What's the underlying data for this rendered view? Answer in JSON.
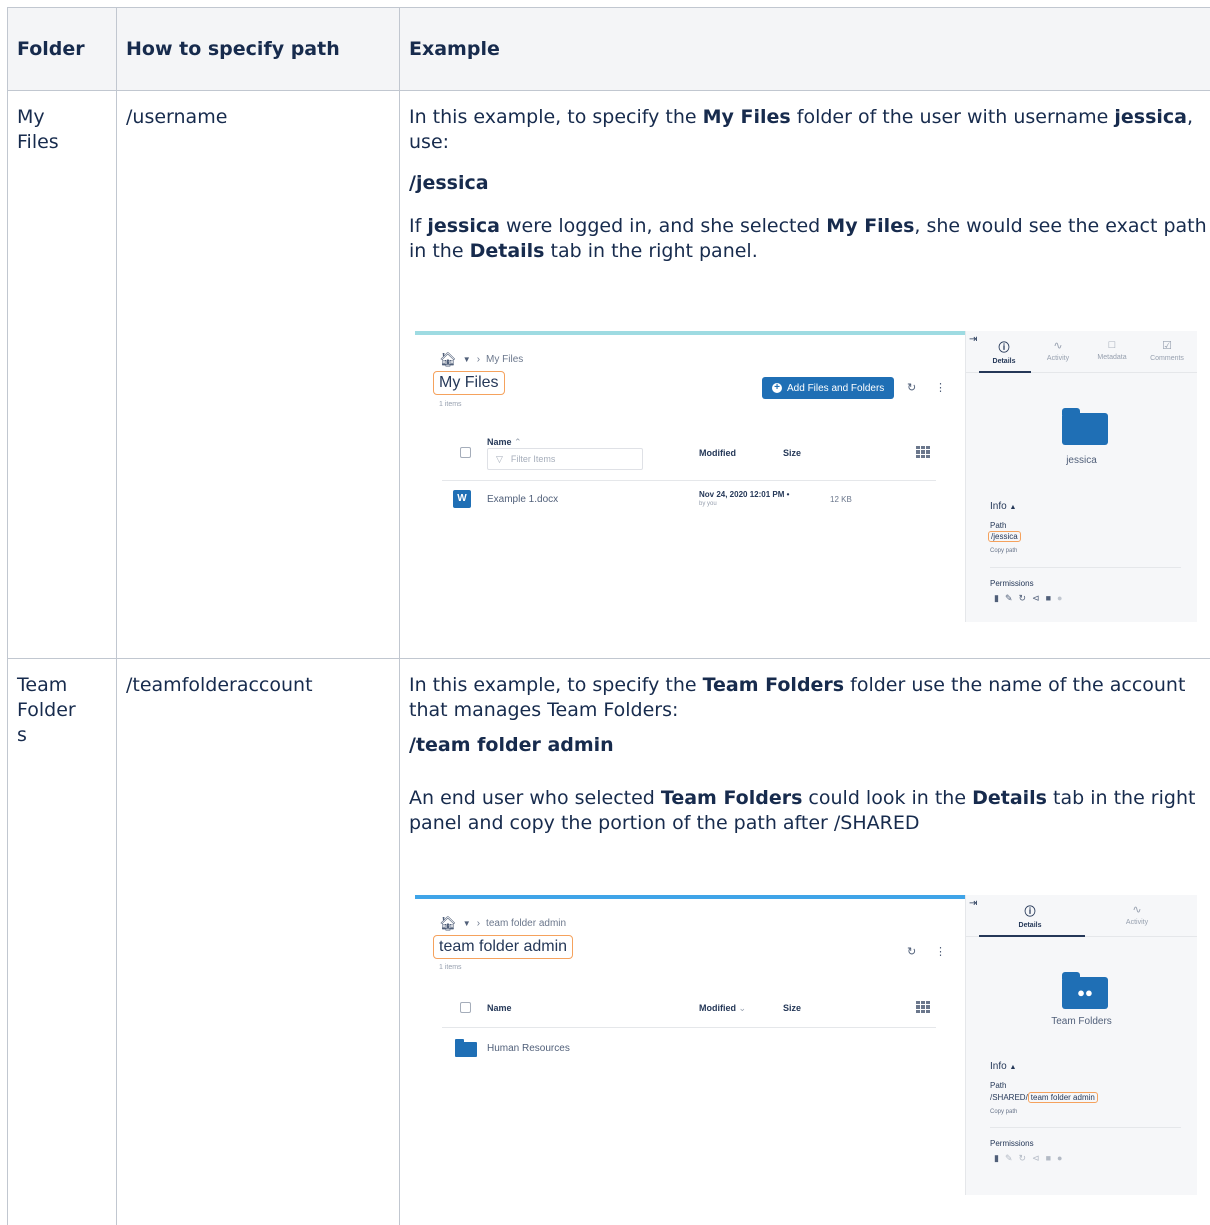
{
  "table": {
    "headers": [
      "Folder",
      "How to specify path",
      "Example"
    ],
    "rows": [
      {
        "folder": "My\nFiles",
        "path_spec": "/username",
        "example": {
          "p1_a": "In this example, to specify the ",
          "p1_b": "My Files",
          "p1_c": " folder of the user with username ",
          "p1_d": "jessica",
          "p1_e": ", use:",
          "path": "/jessica",
          "p2_a": "If ",
          "p2_b": "jessica",
          "p2_c": " were logged in, and she selected ",
          "p2_d": "My Files",
          "p2_e": ", she would see the exact path in the ",
          "p2_f": "Details",
          "p2_g": " tab in the right panel."
        }
      },
      {
        "folder": "Team\nFolder\ns",
        "path_spec": "/teamfolderaccount",
        "example": {
          "p1_a": "In this example, to specify the ",
          "p1_b": "Team Folders",
          "p1_c": " folder use the name of the account that manages Team Folders:",
          "path": "/team folder admin",
          "p2_a": "An end user who selected ",
          "p2_b": "Team Folders",
          "p2_c": " could look in the ",
          "p2_d": "Details",
          "p2_e": " tab in the right panel and copy the portion of the path after /SHARED"
        }
      }
    ]
  },
  "screenshot1": {
    "breadcrumb": "My Files",
    "title": "My Files",
    "items_count": "1 items",
    "add_button": "Add Files and Folders",
    "col_name": "Name",
    "col_modified": "Modified",
    "col_size": "Size",
    "filter_placeholder": "Filter Items",
    "file_name": "Example 1.docx",
    "file_modified": "Nov 24, 2020 12:01 PM",
    "file_modified_by": "by you",
    "file_size": "12 KB",
    "tabs": [
      "Details",
      "Activity",
      "Metadata",
      "Comments"
    ],
    "panel_name": "jessica",
    "info_label": "Info",
    "path_label": "Path",
    "path_value": "/jessica",
    "copy_path": "Copy path",
    "permissions_label": "Permissions",
    "accent_color": "#9edbe2"
  },
  "screenshot2": {
    "breadcrumb": "team folder admin",
    "title": "team folder admin",
    "items_count": "1 items",
    "col_name": "Name",
    "col_modified": "Modified",
    "col_size": "Size",
    "folder_name": "Human Resources",
    "tabs": [
      "Details",
      "Activity"
    ],
    "panel_name": "Team Folders",
    "info_label": "Info",
    "path_label": "Path",
    "path_prefix": "/SHARED/",
    "path_highlight": "team folder admin",
    "copy_path": "Copy path",
    "permissions_label": "Permissions",
    "accent_color": "#3fa4e8"
  }
}
